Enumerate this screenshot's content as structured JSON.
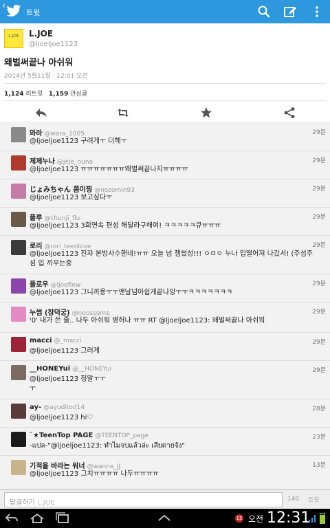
{
  "topbar": {
    "back_glyph": "‹",
    "title": "트윗",
    "bg": "#2d98de"
  },
  "tweet": {
    "avatar_text": "L.JOE",
    "name": "L.JOE",
    "handle": "@ljoeljoe1123",
    "text": "왜벌써끝나 아쉬워",
    "time": "2014년 5월11일 · 12:01 오전",
    "retweets": "1,124",
    "retweets_label": "리트윗",
    "favorites": "1,159",
    "favorites_label": "관심글"
  },
  "replies": [
    {
      "name": "와라",
      "handle": "@wara_1005",
      "text": "@ljoeljoe1123 구려게ㅜ 더해ㅜ",
      "time": "29분"
    },
    {
      "name": "제제누나",
      "handle": "@jeje_nuna",
      "text": "@ljoeljoe1123 ㅠㅠㅠㅠㅠㅠㅠ왜벌써끝나지ㅠㅠㅠㅠ",
      "time": "29분"
    },
    {
      "name": "じょみちゃん 쫌이찡",
      "handle": "@nozomin93",
      "text": "@ljoeljoe1123 보고싶다ㅜ",
      "time": "29분"
    },
    {
      "name": "플루",
      "handle": "@chunji_flu",
      "text": "@ljoeljoe1123 3회연속 편성 해달라구해여! ㅋㅋㅋㅋㅋ큐ㅠㅠㅠ",
      "time": "29분"
    },
    {
      "name": "로리",
      "handle": "@rori_teenlove",
      "text": "@ljoeljoe1123 진쟈 본방사수핸네!ㅠㅠ 오늘 넘 잼썼성!!! ㅇㅁㅇ 누나 입떨어져 나갔서! (주섬주섬 입 끼우는중",
      "time": "29분"
    },
    {
      "name": "플로우",
      "handle": "@ljoeflow",
      "text": "@ljoeljoe1123 그니까용ㅜㅜ맨날넘아쉽게끝나잉ㅜㅜㅋㅋㅋㅋㅋㅋㅋ",
      "time": "29분"
    },
    {
      "name": "누썸 (창덕궁)",
      "handle": "@noussome",
      "text": "'0' 내가 쓴 줄.. 나두 아쉬워 병허나 ㅠㅠ RT @ljoeljoe1123: 왜벌써끝나 아쉬워",
      "time": "29분"
    },
    {
      "name": "macci",
      "handle": "@_macci",
      "text": "@ljoeljoe1123 그러게",
      "time": "29분"
    },
    {
      "name": "__HONEYui",
      "handle": "@__HONEYui",
      "text": "@ljoeljoe1123 정말ㅜㅜㅜ",
      "time": "29분"
    },
    {
      "name": "ay-",
      "handle": "@ayuditod14",
      "text": "@ljoeljoe1123 hi♡",
      "time": "28분"
    },
    {
      "name": "`★TeenTop PAGE",
      "handle": "@TEENTOP_page",
      "text": "-แปล-\"@ljoeljoe1123: ทำไมจบแล้วล่ะ เสียดายจัง\"",
      "time": "23분"
    },
    {
      "name": "기적을 바라는 워너",
      "handle": "@wanna_JJ",
      "text": "@ljoeljoe1123 그치ㅠㅠㅠㅠ 나두ㅠㅠㅠㅠ",
      "time": "13분"
    }
  ],
  "compose": {
    "placeholder": "답글하기",
    "placeholder_target": "L.JOE",
    "char_count": "140",
    "send_label": "트윗"
  },
  "statusbar": {
    "notification_count": "15",
    "ampm": "오전",
    "time": "12:31"
  },
  "icons": {
    "topbar": [
      "twitter-bird-icon",
      "search-icon",
      "compose-icon",
      "overflow-menu-icon"
    ],
    "actions": [
      "reply-icon",
      "retweet-icon",
      "favorite-icon",
      "share-icon"
    ],
    "nav": [
      "back-nav-icon",
      "home-nav-icon",
      "recent-apps-icon",
      "up-chevron-icon"
    ]
  }
}
